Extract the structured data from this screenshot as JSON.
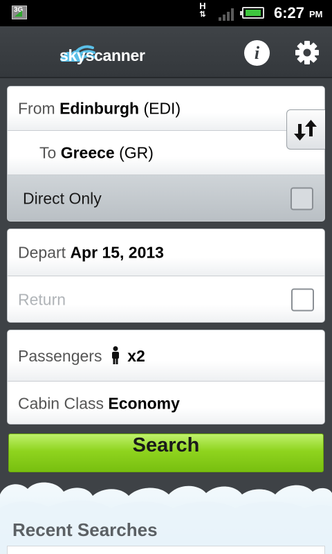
{
  "status_bar": {
    "network_type": "3G",
    "data_indicator": "H",
    "time": "6:27",
    "ampm": "PM"
  },
  "app_bar": {
    "brand": "skyscanner",
    "info_icon": "info-icon",
    "settings_icon": "gear-icon"
  },
  "route": {
    "from_label": "From",
    "from_city": "Edinburgh",
    "from_code": "(EDI)",
    "to_label": "To",
    "to_city": "Greece",
    "to_code": "(GR)",
    "direct_only_label": "Direct Only",
    "direct_only_checked": false,
    "swap_icon": "swap-arrows-icon"
  },
  "dates": {
    "depart_label": "Depart",
    "depart_value": "Apr 15, 2013",
    "return_label": "Return",
    "return_checked": false
  },
  "travellers": {
    "passengers_label": "Passengers",
    "passengers_icon": "person-icon",
    "passengers_value": "x2",
    "cabin_label": "Cabin Class",
    "cabin_value": "Economy"
  },
  "search_button": "Search",
  "recent": {
    "title": "Recent Searches"
  },
  "colors": {
    "brand": "#5bc0e8",
    "search_green": "#8fd41e",
    "app_bar": "#3a3e42"
  }
}
